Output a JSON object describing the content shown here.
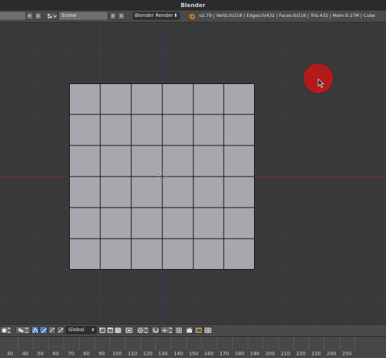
{
  "window": {
    "title": "Blender"
  },
  "info_header": {
    "screen_layout_value": "",
    "scene_value": "Scene",
    "render_engine": "Blender Render",
    "stats": "v2.79 | Verts:0/218 | Edges:0/432 | Faces:0/216 | Tris:432 | Mem:9.17M | Cube"
  },
  "viewport": {
    "mesh_grid": {
      "columns": 6,
      "rows": 6
    },
    "colors": {
      "background": "#393939",
      "face": "#a7a7ad",
      "edge": "#111111",
      "x_axis": "#7b2f2f",
      "y_axis": "#2f3c85",
      "cursor_highlight": "#b21b1b"
    }
  },
  "view3d_header": {
    "orientation_value": "Global"
  },
  "timeline_ruler": {
    "ticks": [
      "30",
      "40",
      "50",
      "60",
      "70",
      "80",
      "90",
      "100",
      "110",
      "120",
      "130",
      "140",
      "150",
      "160",
      "170",
      "180",
      "190",
      "200",
      "210",
      "220",
      "230",
      "240",
      "250"
    ]
  }
}
